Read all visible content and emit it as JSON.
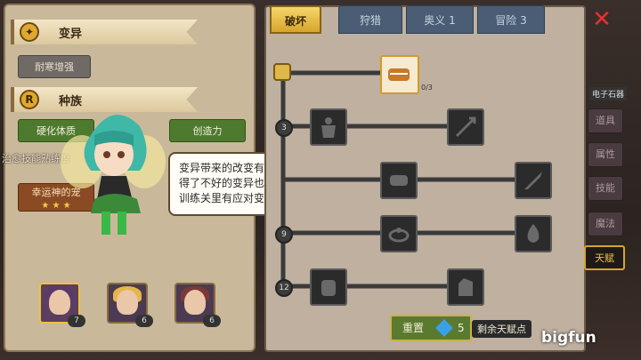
{
  "left": {
    "mutation_header": "变异",
    "mutation_trait": "耐寒增强",
    "race_header": "种族",
    "race_traits": [
      "硬化体质",
      "创造力"
    ],
    "luck_trait": "幸运神的宠",
    "faint_text": "治愈技能熟练度",
    "portraits": [
      {
        "badge": "7"
      },
      {
        "badge": "6"
      },
      {
        "badge": "6"
      }
    ]
  },
  "bubble": {
    "lines": [
      "变异带来的改变有利有弊，",
      "得了不好的变异也不用担心，",
      "训练关里有应对变异的手段。"
    ]
  },
  "tabs": {
    "active": "破坏",
    "others": [
      "狩猎",
      "奥义 1",
      "冒险 3"
    ]
  },
  "tree": {
    "top_counter": "0/3",
    "levels": [
      "3",
      "6",
      "9",
      "12"
    ]
  },
  "footer": {
    "reset_label": "重置",
    "gem_count": "5",
    "remaining_label": "剩余天赋点"
  },
  "side_menu": [
    "道具",
    "属性",
    "技能",
    "魔法",
    "天赋"
  ],
  "card_label": "电子石器",
  "watermark": "bigfun",
  "colors": {
    "accent_gold": "#d6a52c",
    "close_red": "#e83030",
    "reset_green": "#5a7a2f"
  }
}
